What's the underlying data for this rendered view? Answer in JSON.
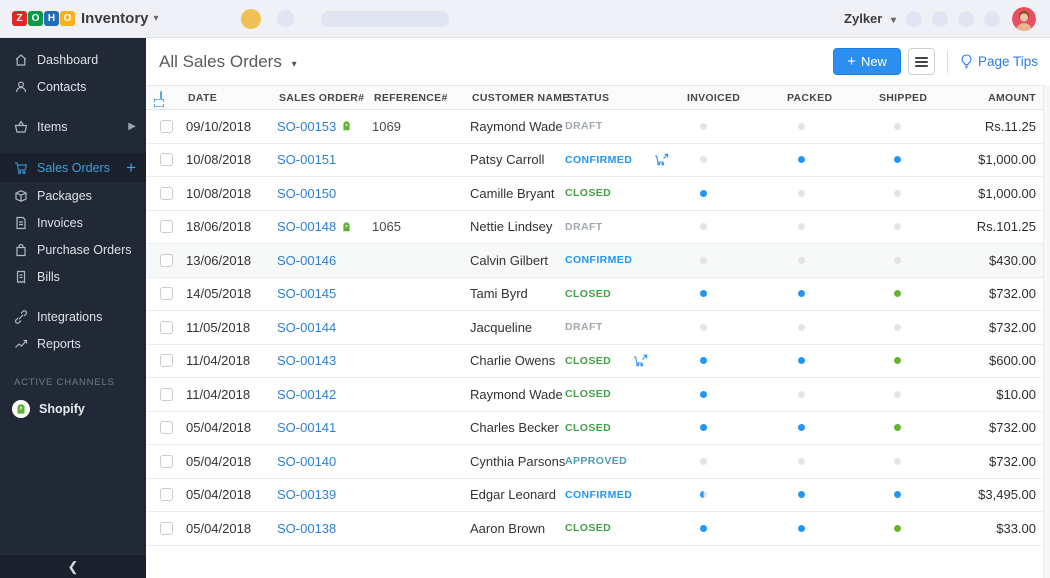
{
  "topbar": {
    "logo": {
      "tiles": [
        {
          "letter": "Z",
          "color": "#e42527"
        },
        {
          "letter": "O",
          "color": "#089949"
        },
        {
          "letter": "H",
          "color": "#226db4"
        },
        {
          "letter": "O",
          "color": "#f9b21d"
        }
      ],
      "product": "Inventory"
    },
    "org_name": "Zylker"
  },
  "sidebar": {
    "items": [
      {
        "label": "Dashboard"
      },
      {
        "label": "Contacts"
      },
      {
        "label": "Items"
      },
      {
        "label": "Sales Orders"
      },
      {
        "label": "Packages"
      },
      {
        "label": "Invoices"
      },
      {
        "label": "Purchase Orders"
      },
      {
        "label": "Bills"
      },
      {
        "label": "Integrations"
      },
      {
        "label": "Reports"
      }
    ],
    "section_label": "ACTIVE CHANNELS",
    "channels": [
      {
        "label": "Shopify"
      }
    ]
  },
  "header": {
    "title": "All Sales Orders",
    "new_button": "New",
    "page_tips": "Page Tips"
  },
  "table": {
    "columns": [
      "DATE",
      "SALES ORDER#",
      "REFERENCE#",
      "CUSTOMER NAME",
      "STATUS",
      "INVOICED",
      "PACKED",
      "SHIPPED",
      "AMOUNT"
    ],
    "rows": [
      {
        "date": "09/10/2018",
        "order": "SO-00153",
        "shopify": true,
        "reference": "1069",
        "customer": "Raymond Wade",
        "status": "DRAFT",
        "cart_icon": false,
        "invoiced": "gray",
        "packed": "gray",
        "shipped": "gray",
        "amount": "Rs.11.25"
      },
      {
        "date": "10/08/2018",
        "order": "SO-00151",
        "shopify": false,
        "reference": "",
        "customer": "Patsy Carroll",
        "status": "CONFIRMED",
        "cart_icon": true,
        "invoiced": "gray",
        "packed": "blue",
        "shipped": "blue",
        "amount": "$1,000.00"
      },
      {
        "date": "10/08/2018",
        "order": "SO-00150",
        "shopify": false,
        "reference": "",
        "customer": "Camille Bryant",
        "status": "CLOSED",
        "cart_icon": false,
        "invoiced": "blue",
        "packed": "gray",
        "shipped": "gray",
        "amount": "$1,000.00"
      },
      {
        "date": "18/06/2018",
        "order": "SO-00148",
        "shopify": true,
        "reference": "1065",
        "customer": "Nettie Lindsey",
        "status": "DRAFT",
        "cart_icon": false,
        "invoiced": "gray",
        "packed": "gray",
        "shipped": "gray",
        "amount": "Rs.101.25"
      },
      {
        "date": "13/06/2018",
        "order": "SO-00146",
        "shopify": false,
        "reference": "",
        "customer": "Calvin Gilbert",
        "status": "CONFIRMED",
        "cart_icon": false,
        "invoiced": "gray",
        "packed": "gray",
        "shipped": "gray",
        "amount": "$430.00",
        "highlight": true
      },
      {
        "date": "14/05/2018",
        "order": "SO-00145",
        "shopify": false,
        "reference": "",
        "customer": "Tami Byrd",
        "status": "CLOSED",
        "cart_icon": false,
        "invoiced": "blue",
        "packed": "blue",
        "shipped": "green",
        "amount": "$732.00"
      },
      {
        "date": "11/05/2018",
        "order": "SO-00144",
        "shopify": false,
        "reference": "",
        "customer": "Jacqueline",
        "status": "DRAFT",
        "cart_icon": false,
        "invoiced": "gray",
        "packed": "gray",
        "shipped": "gray",
        "amount": "$732.00"
      },
      {
        "date": "11/04/2018",
        "order": "SO-00143",
        "shopify": false,
        "reference": "",
        "customer": "Charlie Owens",
        "status": "CLOSED",
        "cart_icon": true,
        "invoiced": "blue",
        "packed": "blue",
        "shipped": "green",
        "amount": "$600.00"
      },
      {
        "date": "11/04/2018",
        "order": "SO-00142",
        "shopify": false,
        "reference": "",
        "customer": "Raymond Wade",
        "status": "CLOSED",
        "cart_icon": false,
        "invoiced": "blue",
        "packed": "gray",
        "shipped": "gray",
        "amount": "$10.00"
      },
      {
        "date": "05/04/2018",
        "order": "SO-00141",
        "shopify": false,
        "reference": "",
        "customer": "Charles Becker",
        "status": "CLOSED",
        "cart_icon": false,
        "invoiced": "blue",
        "packed": "blue",
        "shipped": "green",
        "amount": "$732.00"
      },
      {
        "date": "05/04/2018",
        "order": "SO-00140",
        "shopify": false,
        "reference": "",
        "customer": "Cynthia Parsons",
        "status": "APPROVED",
        "cart_icon": false,
        "invoiced": "gray",
        "packed": "gray",
        "shipped": "gray",
        "amount": "$732.00"
      },
      {
        "date": "05/04/2018",
        "order": "SO-00139",
        "shopify": false,
        "reference": "",
        "customer": "Edgar Leonard",
        "status": "CONFIRMED",
        "cart_icon": false,
        "invoiced": "half",
        "packed": "blue",
        "shipped": "blue",
        "amount": "$3,495.00"
      },
      {
        "date": "05/04/2018",
        "order": "SO-00138",
        "shopify": false,
        "reference": "",
        "customer": "Aaron Brown",
        "status": "CLOSED",
        "cart_icon": false,
        "invoiced": "blue",
        "packed": "blue",
        "shipped": "green",
        "amount": "$33.00"
      }
    ]
  },
  "colors": {
    "accent_blue": "#2b8ff2",
    "link_blue": "#2f80d3",
    "shopify_green": "#5fb332",
    "status": {
      "DRAFT": "#a3a8ae",
      "CONFIRMED": "#2196f3",
      "CLOSED": "#44a048",
      "APPROVED": "#4e9cb9"
    },
    "dots": {
      "blue": "#2196f3",
      "green": "#64b52d",
      "gray": "#e4e4e4"
    }
  }
}
